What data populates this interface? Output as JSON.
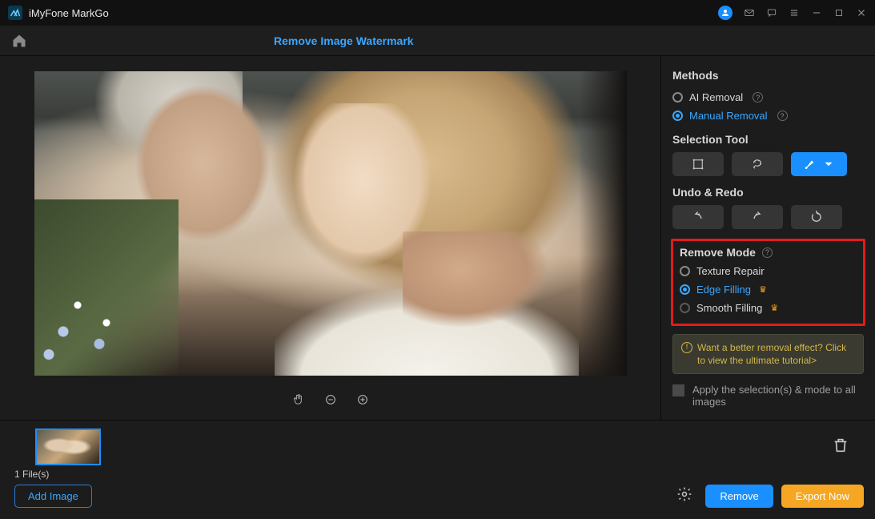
{
  "titlebar": {
    "app_name": "iMyFone MarkGo"
  },
  "header": {
    "tab_label": "Remove Image Watermark"
  },
  "sidebar": {
    "methods": {
      "title": "Methods",
      "ai_label": "AI Removal",
      "manual_label": "Manual Removal"
    },
    "selection_tool": {
      "title": "Selection Tool"
    },
    "undo_redo": {
      "title": "Undo & Redo"
    },
    "remove_mode": {
      "title": "Remove Mode",
      "texture_label": "Texture Repair",
      "edge_label": "Edge Filling",
      "smooth_label": "Smooth Filling"
    },
    "tutorial_text": "Want a better removal effect? Click to view the ultimate tutorial>",
    "apply_label": "Apply the selection(s) & mode to all images"
  },
  "footer": {
    "file_count": "1 File(s)",
    "add_image": "Add Image",
    "remove": "Remove",
    "export": "Export Now"
  }
}
